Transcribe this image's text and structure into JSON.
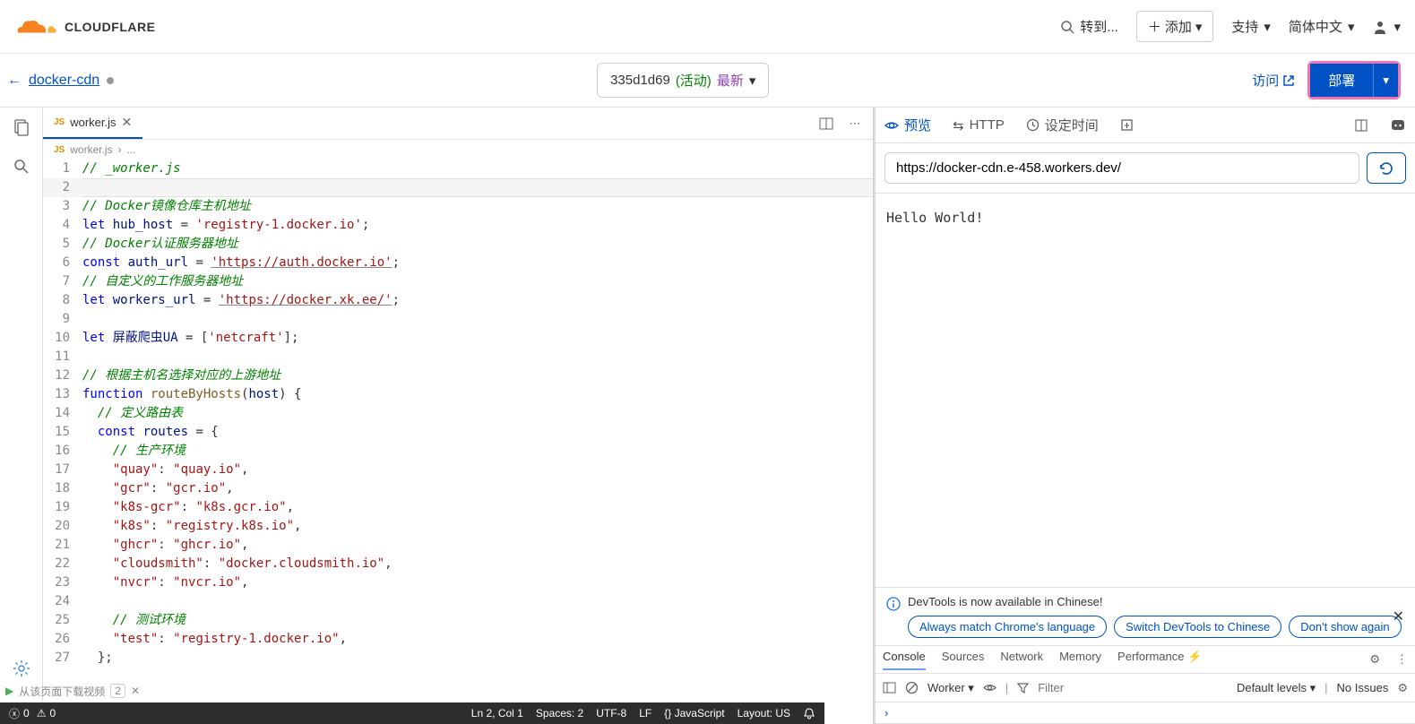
{
  "brand": {
    "name": "CLOUDFLARE"
  },
  "header": {
    "goto": "转到...",
    "add": "添加",
    "support": "支持",
    "language": "简体中文"
  },
  "subheader": {
    "project_name": "docker-cdn",
    "version_hash": "335d1d69",
    "version_status": "(活动)",
    "version_tag": "最新",
    "visit": "访问",
    "deploy": "部署"
  },
  "editor": {
    "tab_name": "worker.js",
    "breadcrumb_file": "worker.js",
    "breadcrumb_more": "...",
    "lines": [
      {
        "n": 1,
        "tokens": [
          {
            "t": "// _worker.js",
            "c": "c-comment"
          }
        ]
      },
      {
        "n": 2,
        "current": true,
        "tokens": []
      },
      {
        "n": 3,
        "tokens": [
          {
            "t": "// Docker镜像仓库主机地址",
            "c": "c-comment"
          }
        ]
      },
      {
        "n": 4,
        "tokens": [
          {
            "t": "let ",
            "c": "c-keyword"
          },
          {
            "t": "hub_host",
            "c": "c-var"
          },
          {
            "t": " = "
          },
          {
            "t": "'registry-1.docker.io'",
            "c": "c-string"
          },
          {
            "t": ";"
          }
        ]
      },
      {
        "n": 5,
        "tokens": [
          {
            "t": "// Docker认证服务器地址",
            "c": "c-comment"
          }
        ]
      },
      {
        "n": 6,
        "tokens": [
          {
            "t": "const ",
            "c": "c-keyword"
          },
          {
            "t": "auth_url",
            "c": "c-var"
          },
          {
            "t": " = "
          },
          {
            "t": "'https://auth.docker.io'",
            "c": "c-string c-url"
          },
          {
            "t": ";"
          }
        ]
      },
      {
        "n": 7,
        "tokens": [
          {
            "t": "// 自定义的工作服务器地址",
            "c": "c-comment"
          }
        ]
      },
      {
        "n": 8,
        "tokens": [
          {
            "t": "let ",
            "c": "c-keyword"
          },
          {
            "t": "workers_url",
            "c": "c-var"
          },
          {
            "t": " = "
          },
          {
            "t": "'https://docker.xk.ee/'",
            "c": "c-string c-url"
          },
          {
            "t": ";"
          }
        ]
      },
      {
        "n": 9,
        "tokens": []
      },
      {
        "n": 10,
        "tokens": [
          {
            "t": "let ",
            "c": "c-keyword"
          },
          {
            "t": "屏蔽爬虫UA",
            "c": "c-var"
          },
          {
            "t": " = ["
          },
          {
            "t": "'netcraft'",
            "c": "c-string"
          },
          {
            "t": "];"
          }
        ]
      },
      {
        "n": 11,
        "tokens": []
      },
      {
        "n": 12,
        "tokens": [
          {
            "t": "// 根据主机名选择对应的上游地址",
            "c": "c-comment"
          }
        ]
      },
      {
        "n": 13,
        "tokens": [
          {
            "t": "function ",
            "c": "c-keyword"
          },
          {
            "t": "routeByHosts",
            "c": "c-func"
          },
          {
            "t": "("
          },
          {
            "t": "host",
            "c": "c-param"
          },
          {
            "t": ") {"
          }
        ]
      },
      {
        "n": 14,
        "indent": 1,
        "tokens": [
          {
            "t": "// 定义路由表",
            "c": "c-comment"
          }
        ]
      },
      {
        "n": 15,
        "indent": 1,
        "tokens": [
          {
            "t": "const ",
            "c": "c-keyword"
          },
          {
            "t": "routes",
            "c": "c-var"
          },
          {
            "t": " = {"
          }
        ]
      },
      {
        "n": 16,
        "indent": 2,
        "tokens": [
          {
            "t": "// 生产环境",
            "c": "c-comment"
          }
        ]
      },
      {
        "n": 17,
        "indent": 2,
        "tokens": [
          {
            "t": "\"quay\"",
            "c": "c-string"
          },
          {
            "t": ": "
          },
          {
            "t": "\"quay.io\"",
            "c": "c-string"
          },
          {
            "t": ","
          }
        ]
      },
      {
        "n": 18,
        "indent": 2,
        "tokens": [
          {
            "t": "\"gcr\"",
            "c": "c-string"
          },
          {
            "t": ": "
          },
          {
            "t": "\"gcr.io\"",
            "c": "c-string"
          },
          {
            "t": ","
          }
        ]
      },
      {
        "n": 19,
        "indent": 2,
        "tokens": [
          {
            "t": "\"k8s-gcr\"",
            "c": "c-string"
          },
          {
            "t": ": "
          },
          {
            "t": "\"k8s.gcr.io\"",
            "c": "c-string"
          },
          {
            "t": ","
          }
        ]
      },
      {
        "n": 20,
        "indent": 2,
        "tokens": [
          {
            "t": "\"k8s\"",
            "c": "c-string"
          },
          {
            "t": ": "
          },
          {
            "t": "\"registry.k8s.io\"",
            "c": "c-string"
          },
          {
            "t": ","
          }
        ]
      },
      {
        "n": 21,
        "indent": 2,
        "tokens": [
          {
            "t": "\"ghcr\"",
            "c": "c-string"
          },
          {
            "t": ": "
          },
          {
            "t": "\"ghcr.io\"",
            "c": "c-string"
          },
          {
            "t": ","
          }
        ]
      },
      {
        "n": 22,
        "indent": 2,
        "tokens": [
          {
            "t": "\"cloudsmith\"",
            "c": "c-string"
          },
          {
            "t": ": "
          },
          {
            "t": "\"docker.cloudsmith.io\"",
            "c": "c-string"
          },
          {
            "t": ","
          }
        ]
      },
      {
        "n": 23,
        "indent": 2,
        "tokens": [
          {
            "t": "\"nvcr\"",
            "c": "c-string"
          },
          {
            "t": ": "
          },
          {
            "t": "\"nvcr.io\"",
            "c": "c-string"
          },
          {
            "t": ","
          }
        ]
      },
      {
        "n": 24,
        "indent": 2,
        "tokens": []
      },
      {
        "n": 25,
        "indent": 2,
        "tokens": [
          {
            "t": "// 测试环境",
            "c": "c-comment"
          }
        ]
      },
      {
        "n": 26,
        "indent": 2,
        "tokens": [
          {
            "t": "\"test\"",
            "c": "c-string"
          },
          {
            "t": ": "
          },
          {
            "t": "\"registry-1.docker.io\"",
            "c": "c-string"
          },
          {
            "t": ","
          }
        ]
      },
      {
        "n": 27,
        "indent": 1,
        "tokens": [
          {
            "t": "};"
          }
        ]
      }
    ]
  },
  "statusbar": {
    "errors": "0",
    "warnings": "0",
    "position": "Ln 2, Col 1",
    "spaces": "Spaces: 2",
    "encoding": "UTF-8",
    "eol": "LF",
    "lang": "JavaScript",
    "layout": "Layout: US"
  },
  "footer_toolbar": {
    "text": "从该页面下载视频",
    "badge": "2"
  },
  "preview": {
    "tabs": {
      "preview": "预览",
      "http": "HTTP",
      "schedule": "设定时间"
    },
    "url": "https://docker-cdn.e-458.workers.dev/",
    "body": "Hello World!"
  },
  "devtools_notice": {
    "message": "DevTools is now available in Chinese!",
    "pills": [
      "Always match Chrome's language",
      "Switch DevTools to Chinese",
      "Don't show again"
    ]
  },
  "devtools": {
    "tabs": [
      "Console",
      "Sources",
      "Network",
      "Memory",
      "Performance ⚡"
    ],
    "active_tab": "Console",
    "context": "Worker",
    "filter_placeholder": "Filter",
    "levels": "Default levels",
    "issues": "No Issues"
  }
}
